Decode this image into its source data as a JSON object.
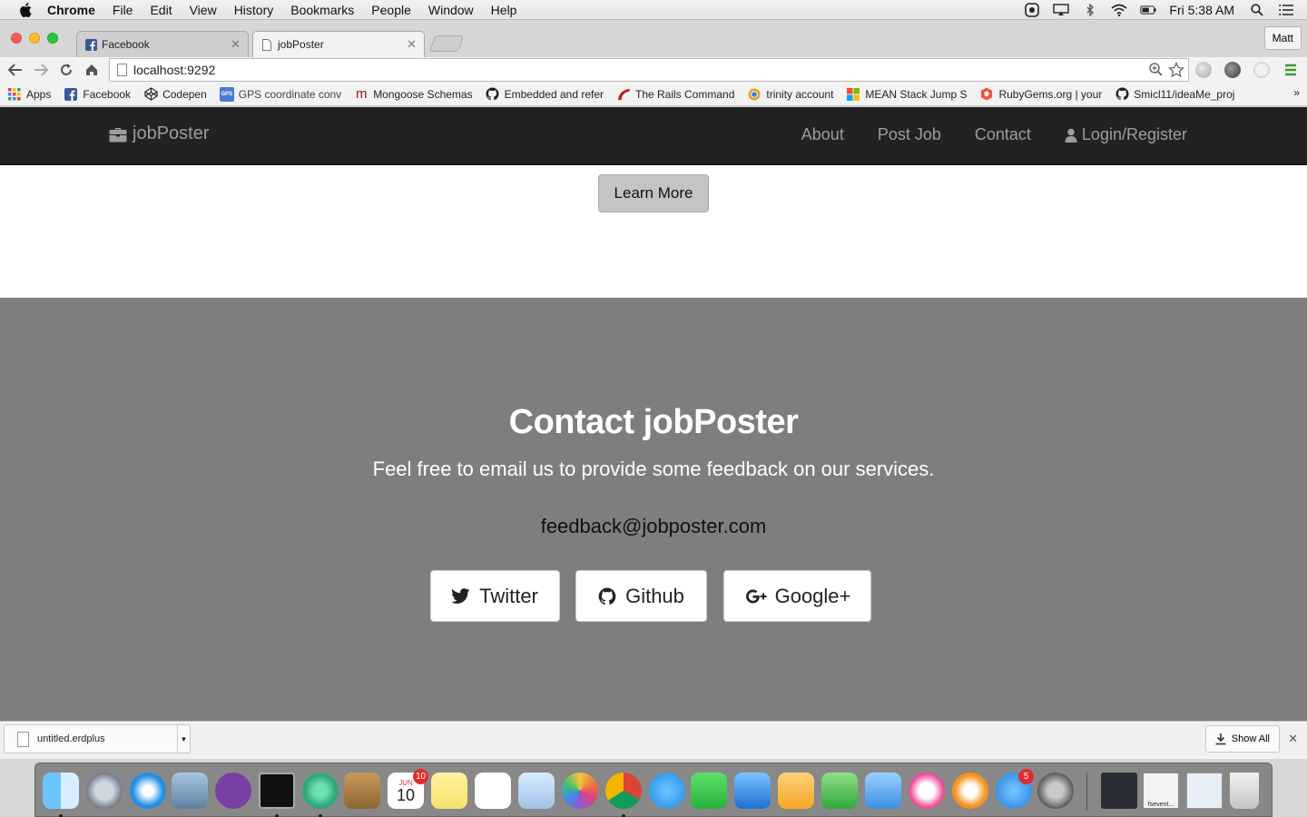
{
  "menubar": {
    "app": "Chrome",
    "items": [
      "File",
      "Edit",
      "View",
      "History",
      "Bookmarks",
      "People",
      "Window",
      "Help"
    ],
    "clock": "Fri 5:38 AM",
    "status_icons": [
      "adobe-icon",
      "airplay-icon",
      "bluetooth-icon",
      "wifi-icon",
      "battery-icon",
      "spotlight-icon",
      "notification-center-icon"
    ]
  },
  "browser": {
    "tabs": [
      {
        "title": "Facebook",
        "active": false
      },
      {
        "title": "jobPoster",
        "active": true
      }
    ],
    "profile": "Matt",
    "url": "localhost:9292",
    "bookmarks": [
      {
        "label": "Apps",
        "icon": "apps-grid-icon"
      },
      {
        "label": "Facebook",
        "icon": "facebook-icon"
      },
      {
        "label": "Codepen",
        "icon": "codepen-icon"
      },
      {
        "label": "GPS coordinate conv",
        "icon": "gps-icon"
      },
      {
        "label": "Mongoose Schemas",
        "icon": "mongoose-icon"
      },
      {
        "label": "Embedded and refer",
        "icon": "github-icon"
      },
      {
        "label": "The Rails Command",
        "icon": "rails-icon"
      },
      {
        "label": "trinity account",
        "icon": "chrome-icon"
      },
      {
        "label": "MEAN Stack Jump S",
        "icon": "windows-icon"
      },
      {
        "label": "RubyGems.org | your",
        "icon": "rubygems-icon"
      },
      {
        "label": "Smicl11/ideaMe_proj",
        "icon": "github-icon"
      }
    ],
    "bookmarks_more": "»"
  },
  "site": {
    "brand": "jobPoster",
    "nav": [
      "About",
      "Post Job",
      "Contact",
      "Login/Register"
    ],
    "learn_more": "Learn More",
    "contact": {
      "title": "Contact jobPoster",
      "lead": "Feel free to email us to provide some feedback on our services.",
      "email": "feedback@jobposter.com",
      "buttons": [
        {
          "label": "Twitter",
          "icon": "twitter-icon"
        },
        {
          "label": "Github",
          "icon": "github-icon"
        },
        {
          "label": "Google+",
          "icon": "google-plus-icon"
        }
      ]
    }
  },
  "downloads": {
    "file": "untitled.erdplus",
    "show_all": "Show All"
  },
  "dock": {
    "calendar_month": "JUN",
    "calendar_day": "10",
    "calendar_badge": "10",
    "appstore_badge": "5",
    "finder_label": "fsevent...",
    "apps": [
      "finder-icon",
      "launchpad-icon",
      "safari-icon",
      "mail-icon",
      "github-desktop-icon",
      "terminal-icon",
      "atom-icon",
      "contacts-icon",
      "calendar-icon",
      "notes-icon",
      "reminders-icon",
      "preview-icon",
      "photos-icon",
      "chrome-icon",
      "messages-icon",
      "facetime-icon",
      "xcode-icon",
      "pages-icon",
      "numbers-icon",
      "keynote-icon",
      "itunes-icon",
      "ibooks-icon",
      "app-store-icon",
      "system-preferences-icon"
    ]
  }
}
